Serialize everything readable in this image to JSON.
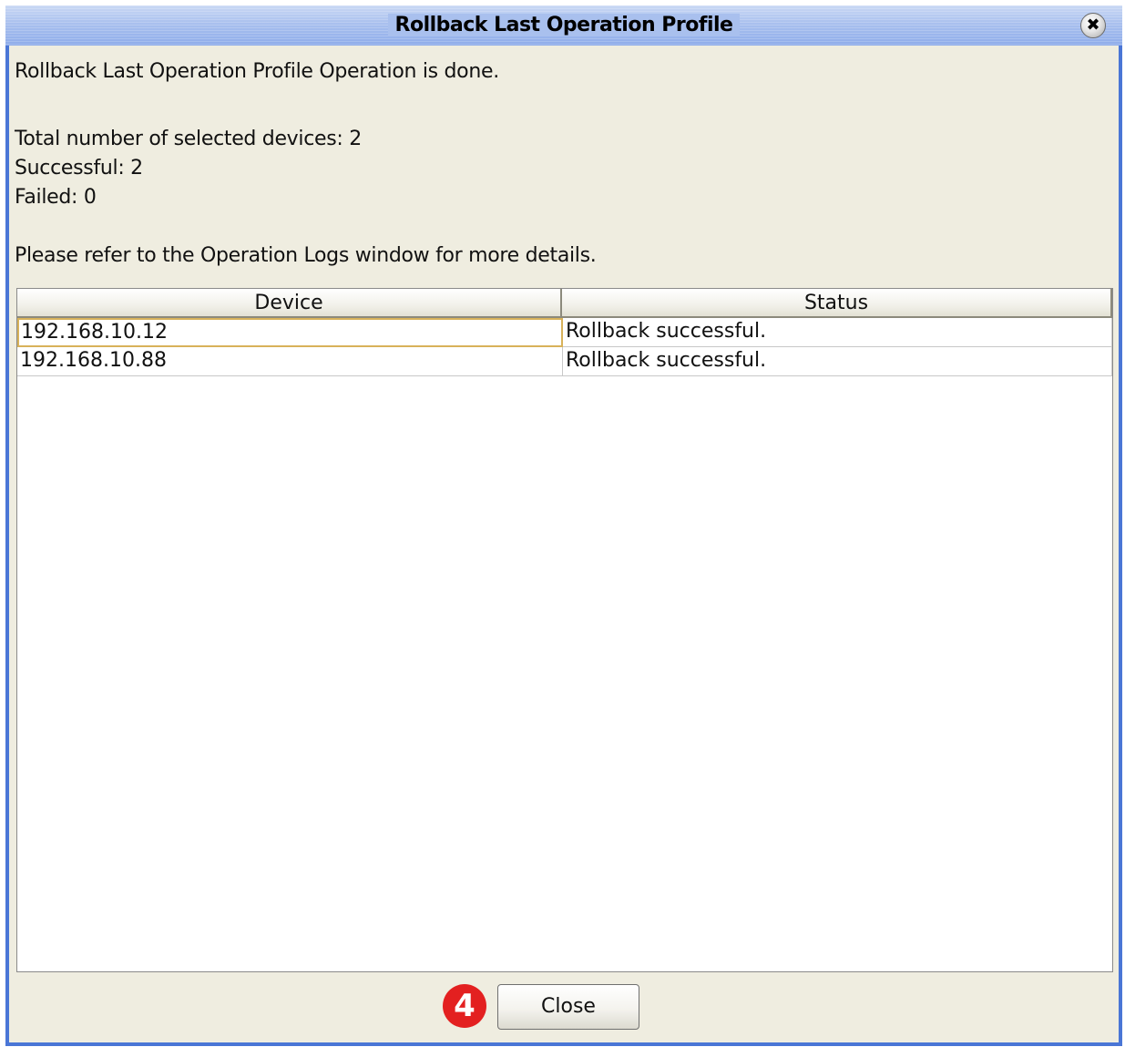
{
  "window": {
    "title": "Rollback Last Operation Profile",
    "close_glyph": "✖",
    "close_icon": "close-icon"
  },
  "message": {
    "line1": "Rollback Last Operation Profile Operation is done.",
    "total": "Total number of selected devices: 2",
    "successful": "Successful: 2",
    "failed": "Failed: 0",
    "refer": "Please refer to the Operation Logs window for more details."
  },
  "table": {
    "columns": [
      "Device",
      "Status"
    ],
    "rows": [
      {
        "device": "192.168.10.12",
        "status": "Rollback successful."
      },
      {
        "device": "192.168.10.88",
        "status": "Rollback successful."
      }
    ]
  },
  "footer": {
    "callout_number": "4",
    "close_label": "Close"
  },
  "colors": {
    "dialog_border": "#4a76d6",
    "titlebar": "#a9c0ee",
    "body_background": "#efede0",
    "callout": "#e32020",
    "focus_cell_border": "#d8b25a"
  }
}
